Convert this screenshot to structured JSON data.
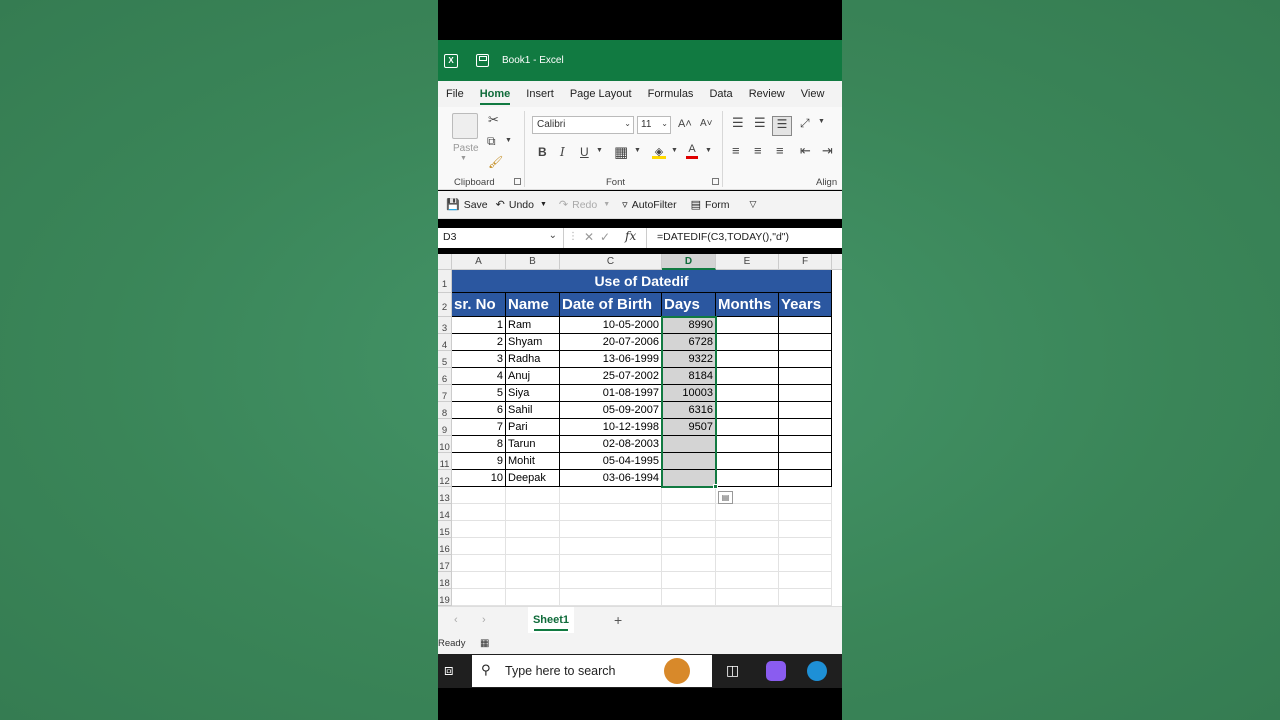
{
  "window": {
    "title": "Book1  -  Excel"
  },
  "menu": [
    "File",
    "Home",
    "Insert",
    "Page Layout",
    "Formulas",
    "Data",
    "Review",
    "View"
  ],
  "ribbon": {
    "paste_label": "Paste",
    "clipboard_label": "Clipboard",
    "font_label": "Font",
    "alignment_label": "Align",
    "font_name": "Calibri",
    "font_size": "11",
    "bold": "B",
    "italic": "I",
    "underline": "U",
    "grow": "A˄",
    "shrink": "A˅",
    "fontcolor": "A"
  },
  "qat": {
    "save": "Save",
    "undo": "Undo",
    "redo": "Redo",
    "autofilter": "AutoFilter",
    "form": "Form"
  },
  "formula_bar": {
    "name_box": "D3",
    "fx": "fx",
    "formula": "=DATEDIF(C3,TODAY(),\"d\")"
  },
  "columns": [
    "A",
    "B",
    "C",
    "D",
    "E",
    "F"
  ],
  "rows": [
    "1",
    "2",
    "3",
    "4",
    "5",
    "6",
    "7",
    "8",
    "9",
    "10",
    "11",
    "12",
    "13",
    "14",
    "15",
    "16",
    "17",
    "18",
    "19"
  ],
  "table": {
    "title": "Use of Datedif",
    "headers": [
      "sr. No",
      "Name",
      "Date of Birth",
      "Days",
      "Months",
      "Years"
    ],
    "data": [
      [
        "1",
        "Ram",
        "10-05-2000",
        "8990"
      ],
      [
        "2",
        "Shyam",
        "20-07-2006",
        "6728"
      ],
      [
        "3",
        "Radha",
        "13-06-1999",
        "9322"
      ],
      [
        "4",
        "Anuj",
        "25-07-2002",
        "8184"
      ],
      [
        "5",
        "Siya",
        "01-08-1997",
        "10003"
      ],
      [
        "6",
        "Sahil",
        "05-09-2007",
        "6316"
      ],
      [
        "7",
        "Pari",
        "10-12-1998",
        "9507"
      ],
      [
        "8",
        "Tarun",
        "02-08-2003",
        ""
      ],
      [
        "9",
        "Mohit",
        "05-04-1995",
        ""
      ],
      [
        "10",
        "Deepak",
        "03-06-1994",
        ""
      ]
    ]
  },
  "sheet_tab": "Sheet1",
  "add_sheet": "+",
  "status": "Ready",
  "taskbar": {
    "search_placeholder": "Type here to search"
  },
  "colors": {
    "excel_green": "#117a41",
    "header_blue": "#2b57a0",
    "selection_gray": "#d4d4d4"
  }
}
